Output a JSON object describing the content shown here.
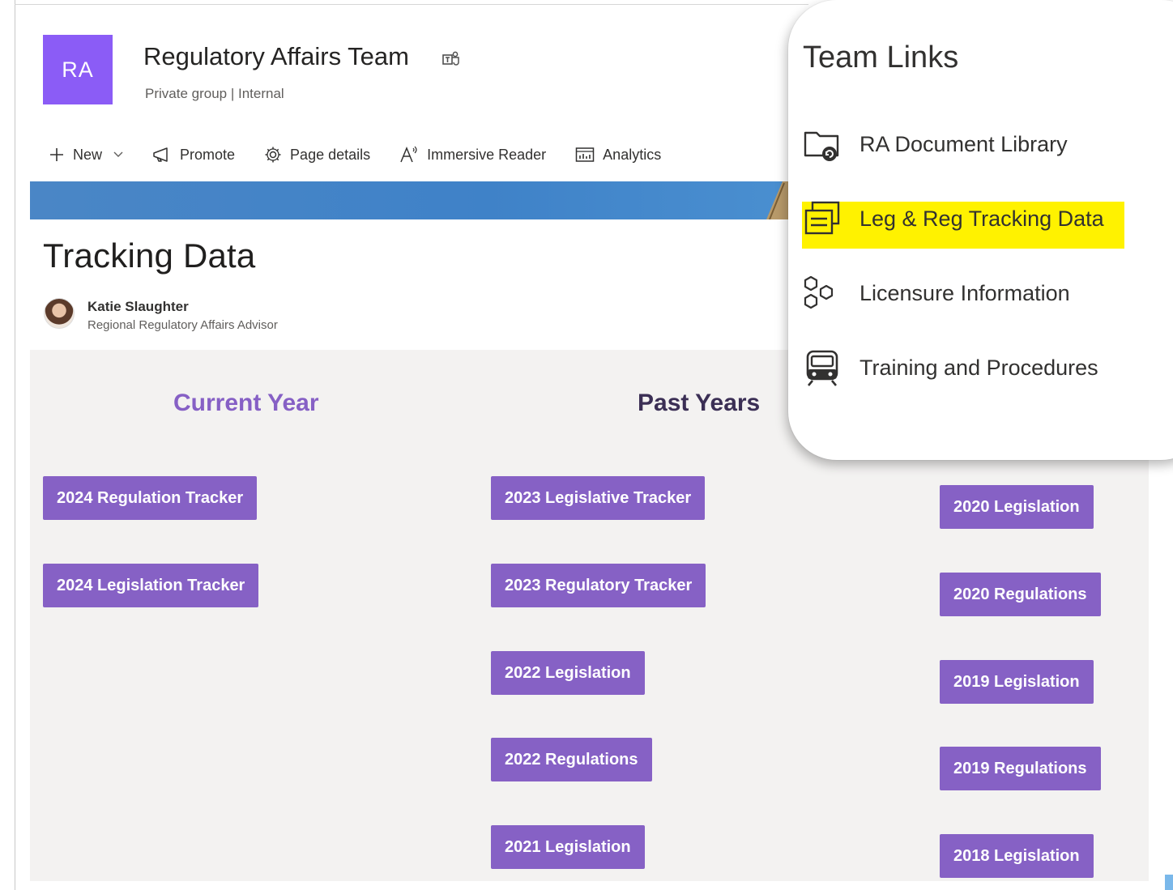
{
  "site": {
    "logo_text": "RA",
    "logo_color": "#8b5cf6",
    "title": "Regulatory Affairs Team",
    "subtitle": "Private group | Internal"
  },
  "command_bar": {
    "new_label": "New",
    "promote_label": "Promote",
    "page_details_label": "Page details",
    "immersive_reader_label": "Immersive Reader",
    "analytics_label": "Analytics"
  },
  "page": {
    "title": "Tracking Data",
    "author_name": "Katie Slaughter",
    "author_role": "Regional Regulatory Affairs Advisor"
  },
  "columns": {
    "current_heading": "Current Year",
    "past_heading": "Past Years"
  },
  "buttons": {
    "current": [
      "2024 Regulation Tracker",
      "2024 Legislation Tracker"
    ],
    "past": [
      "2023 Legislative Tracker",
      "2023 Regulatory Tracker",
      "2022 Legislation",
      "2022 Regulations",
      "2021 Legislation"
    ],
    "older": [
      "2020 Legislation",
      "2020 Regulations",
      "2019 Legislation",
      "2019 Regulations",
      "2018 Legislation"
    ]
  },
  "team_links": {
    "title": "Team Links",
    "items": [
      {
        "label": "RA Document Library",
        "icon": "folder-sync-icon"
      },
      {
        "label": "Leg & Reg Tracking Data",
        "icon": "list-stack-icon",
        "highlighted": true
      },
      {
        "label": "Licensure Information",
        "icon": "hexagons-icon"
      },
      {
        "label": "Training and Procedures",
        "icon": "train-icon"
      }
    ]
  },
  "colors": {
    "button_purple": "#8661c5",
    "heading_purple": "#8660c5",
    "highlight_yellow": "#fff200",
    "banner_blue": "#4a86c6"
  }
}
